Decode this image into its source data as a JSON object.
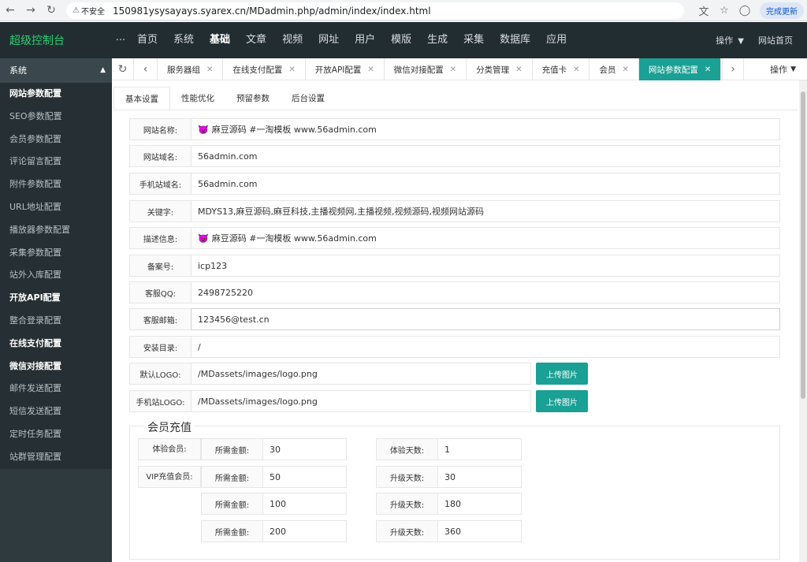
{
  "browser": {
    "security_label": "不安全",
    "url": "150981ysysayays.syarex.cn/MDadmin.php/admin/index/index.html",
    "update_label": "完成更新"
  },
  "topbar": {
    "brand": "超级控制台",
    "dots": "···",
    "nav": [
      "首页",
      "系统",
      "基础",
      "文章",
      "视频",
      "网址",
      "用户",
      "模版",
      "生成",
      "采集",
      "数据库",
      "应用"
    ],
    "active_index": 2,
    "operations": "操作",
    "site_home": "网站首页"
  },
  "sidebar": {
    "header": "系统",
    "items": [
      {
        "label": "网站参数配置",
        "bold": true
      },
      {
        "label": "SEO参数配置",
        "bold": false
      },
      {
        "label": "会员参数配置",
        "bold": false
      },
      {
        "label": "评论留言配置",
        "bold": false
      },
      {
        "label": "附件参数配置",
        "bold": false
      },
      {
        "label": "URL地址配置",
        "bold": false
      },
      {
        "label": "播放器参数配置",
        "bold": false
      },
      {
        "label": "采集参数配置",
        "bold": false
      },
      {
        "label": "站外入库配置",
        "bold": false
      },
      {
        "label": "开放API配置",
        "bold": true
      },
      {
        "label": "整合登录配置",
        "bold": false
      },
      {
        "label": "在线支付配置",
        "bold": true
      },
      {
        "label": "微信对接配置",
        "bold": true
      },
      {
        "label": "邮件发送配置",
        "bold": false
      },
      {
        "label": "短信发送配置",
        "bold": false
      },
      {
        "label": "定时任务配置",
        "bold": false
      },
      {
        "label": "站群管理配置",
        "bold": false
      }
    ]
  },
  "tabstrip": {
    "tabs": [
      "服务器组",
      "在线支付配置",
      "开放API配置",
      "微信对接配置",
      "分类管理",
      "充值卡",
      "会员",
      "网站参数配置"
    ],
    "active_index": 7,
    "operations": "操作"
  },
  "subtabs": {
    "items": [
      "基本设置",
      "性能优化",
      "预留参数",
      "后台设置"
    ],
    "active_index": 0
  },
  "form": {
    "site_name": {
      "label": "网站名称:",
      "value": "麻豆源码 #一淘模板  www.56admin.com"
    },
    "site_domain": {
      "label": "网站域名:",
      "value": "56admin.com"
    },
    "mobile_domain": {
      "label": "手机站域名:",
      "value": "56admin.com"
    },
    "keywords": {
      "label": "关键字:",
      "value": "MDYS13,麻豆源码,麻豆科技,主播视频网,主播视频,视频源码,视频网站源码"
    },
    "description": {
      "label": "描述信息:",
      "value": "麻豆源码 #一淘模板  www.56admin.com"
    },
    "icp": {
      "label": "备案号:",
      "value": "icp123"
    },
    "qq": {
      "label": "客服QQ:",
      "value": "2498725220"
    },
    "email": {
      "label": "客服邮箱:",
      "value": "123456@test.cn"
    },
    "install_dir": {
      "label": "安装目录:",
      "value": "/"
    },
    "default_logo": {
      "label": "默认LOGO:",
      "value": "/MDassets/images/logo.png"
    },
    "mobile_logo": {
      "label": "手机站LOGO:",
      "value": "/MDassets/images/logo.png"
    },
    "upload_label": "上传图片"
  },
  "recharge": {
    "legend": "会员充值",
    "trial_label": "体验会员:",
    "vip_label": "VIP充值会员:",
    "amount_label": "所需金额:",
    "trial_days_label": "体验天数:",
    "upgrade_days_label": "升级天数:",
    "trial": {
      "amount": "30",
      "days": "1"
    },
    "vip": [
      {
        "amount": "50",
        "days": "30"
      },
      {
        "amount": "100",
        "days": "180"
      },
      {
        "amount": "200",
        "days": "360"
      }
    ]
  }
}
